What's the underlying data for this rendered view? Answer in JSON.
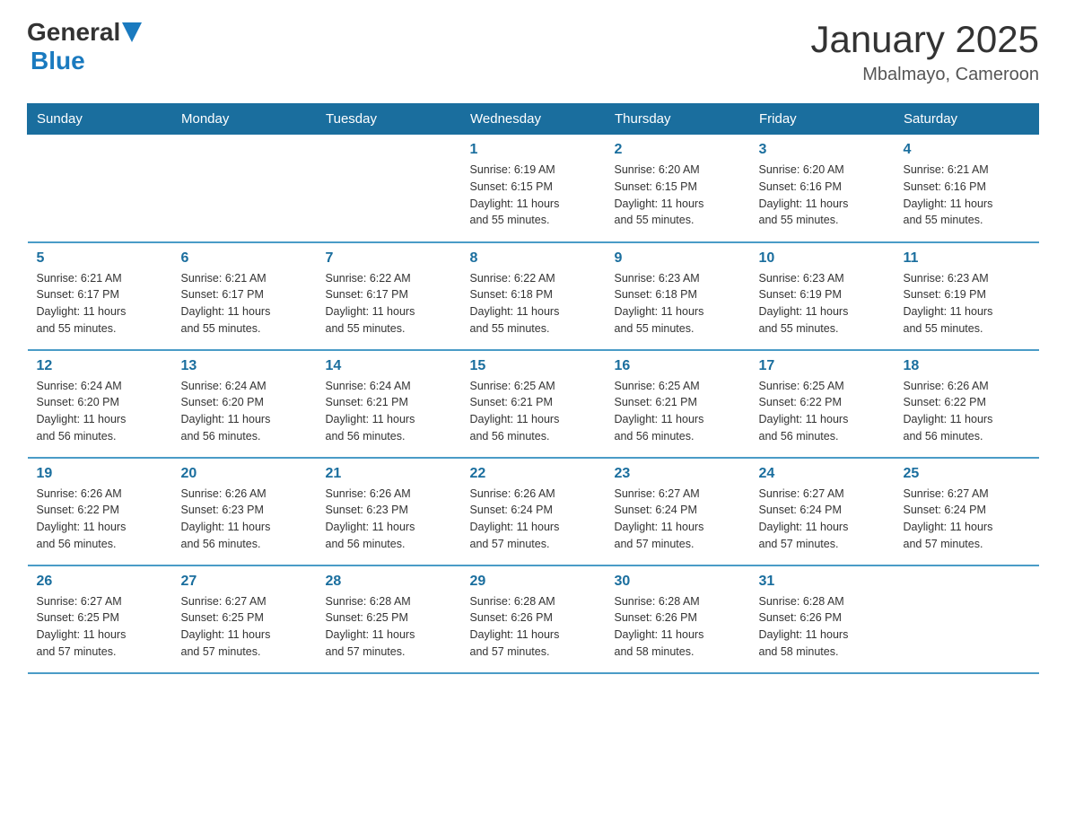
{
  "header": {
    "logo_general": "General",
    "logo_blue": "Blue",
    "title": "January 2025",
    "subtitle": "Mbalmayo, Cameroon"
  },
  "days_of_week": [
    "Sunday",
    "Monday",
    "Tuesday",
    "Wednesday",
    "Thursday",
    "Friday",
    "Saturday"
  ],
  "weeks": [
    [
      {
        "day": "",
        "info": ""
      },
      {
        "day": "",
        "info": ""
      },
      {
        "day": "",
        "info": ""
      },
      {
        "day": "1",
        "info": "Sunrise: 6:19 AM\nSunset: 6:15 PM\nDaylight: 11 hours\nand 55 minutes."
      },
      {
        "day": "2",
        "info": "Sunrise: 6:20 AM\nSunset: 6:15 PM\nDaylight: 11 hours\nand 55 minutes."
      },
      {
        "day": "3",
        "info": "Sunrise: 6:20 AM\nSunset: 6:16 PM\nDaylight: 11 hours\nand 55 minutes."
      },
      {
        "day": "4",
        "info": "Sunrise: 6:21 AM\nSunset: 6:16 PM\nDaylight: 11 hours\nand 55 minutes."
      }
    ],
    [
      {
        "day": "5",
        "info": "Sunrise: 6:21 AM\nSunset: 6:17 PM\nDaylight: 11 hours\nand 55 minutes."
      },
      {
        "day": "6",
        "info": "Sunrise: 6:21 AM\nSunset: 6:17 PM\nDaylight: 11 hours\nand 55 minutes."
      },
      {
        "day": "7",
        "info": "Sunrise: 6:22 AM\nSunset: 6:17 PM\nDaylight: 11 hours\nand 55 minutes."
      },
      {
        "day": "8",
        "info": "Sunrise: 6:22 AM\nSunset: 6:18 PM\nDaylight: 11 hours\nand 55 minutes."
      },
      {
        "day": "9",
        "info": "Sunrise: 6:23 AM\nSunset: 6:18 PM\nDaylight: 11 hours\nand 55 minutes."
      },
      {
        "day": "10",
        "info": "Sunrise: 6:23 AM\nSunset: 6:19 PM\nDaylight: 11 hours\nand 55 minutes."
      },
      {
        "day": "11",
        "info": "Sunrise: 6:23 AM\nSunset: 6:19 PM\nDaylight: 11 hours\nand 55 minutes."
      }
    ],
    [
      {
        "day": "12",
        "info": "Sunrise: 6:24 AM\nSunset: 6:20 PM\nDaylight: 11 hours\nand 56 minutes."
      },
      {
        "day": "13",
        "info": "Sunrise: 6:24 AM\nSunset: 6:20 PM\nDaylight: 11 hours\nand 56 minutes."
      },
      {
        "day": "14",
        "info": "Sunrise: 6:24 AM\nSunset: 6:21 PM\nDaylight: 11 hours\nand 56 minutes."
      },
      {
        "day": "15",
        "info": "Sunrise: 6:25 AM\nSunset: 6:21 PM\nDaylight: 11 hours\nand 56 minutes."
      },
      {
        "day": "16",
        "info": "Sunrise: 6:25 AM\nSunset: 6:21 PM\nDaylight: 11 hours\nand 56 minutes."
      },
      {
        "day": "17",
        "info": "Sunrise: 6:25 AM\nSunset: 6:22 PM\nDaylight: 11 hours\nand 56 minutes."
      },
      {
        "day": "18",
        "info": "Sunrise: 6:26 AM\nSunset: 6:22 PM\nDaylight: 11 hours\nand 56 minutes."
      }
    ],
    [
      {
        "day": "19",
        "info": "Sunrise: 6:26 AM\nSunset: 6:22 PM\nDaylight: 11 hours\nand 56 minutes."
      },
      {
        "day": "20",
        "info": "Sunrise: 6:26 AM\nSunset: 6:23 PM\nDaylight: 11 hours\nand 56 minutes."
      },
      {
        "day": "21",
        "info": "Sunrise: 6:26 AM\nSunset: 6:23 PM\nDaylight: 11 hours\nand 56 minutes."
      },
      {
        "day": "22",
        "info": "Sunrise: 6:26 AM\nSunset: 6:24 PM\nDaylight: 11 hours\nand 57 minutes."
      },
      {
        "day": "23",
        "info": "Sunrise: 6:27 AM\nSunset: 6:24 PM\nDaylight: 11 hours\nand 57 minutes."
      },
      {
        "day": "24",
        "info": "Sunrise: 6:27 AM\nSunset: 6:24 PM\nDaylight: 11 hours\nand 57 minutes."
      },
      {
        "day": "25",
        "info": "Sunrise: 6:27 AM\nSunset: 6:24 PM\nDaylight: 11 hours\nand 57 minutes."
      }
    ],
    [
      {
        "day": "26",
        "info": "Sunrise: 6:27 AM\nSunset: 6:25 PM\nDaylight: 11 hours\nand 57 minutes."
      },
      {
        "day": "27",
        "info": "Sunrise: 6:27 AM\nSunset: 6:25 PM\nDaylight: 11 hours\nand 57 minutes."
      },
      {
        "day": "28",
        "info": "Sunrise: 6:28 AM\nSunset: 6:25 PM\nDaylight: 11 hours\nand 57 minutes."
      },
      {
        "day": "29",
        "info": "Sunrise: 6:28 AM\nSunset: 6:26 PM\nDaylight: 11 hours\nand 57 minutes."
      },
      {
        "day": "30",
        "info": "Sunrise: 6:28 AM\nSunset: 6:26 PM\nDaylight: 11 hours\nand 58 minutes."
      },
      {
        "day": "31",
        "info": "Sunrise: 6:28 AM\nSunset: 6:26 PM\nDaylight: 11 hours\nand 58 minutes."
      },
      {
        "day": "",
        "info": ""
      }
    ]
  ]
}
